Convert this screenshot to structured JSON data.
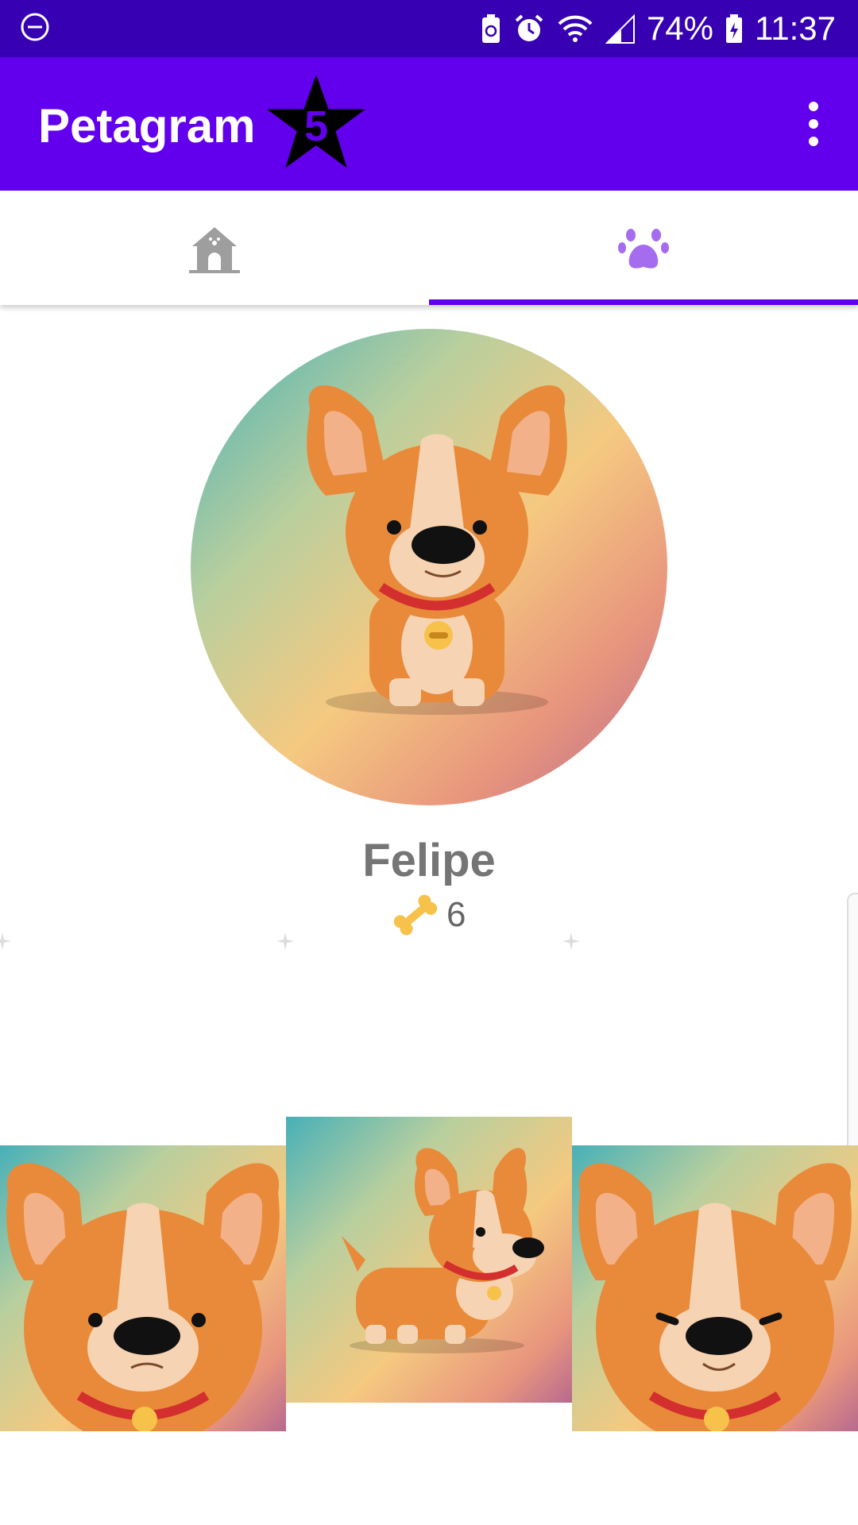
{
  "status_bar": {
    "battery": "74%",
    "time": "11:37",
    "icons": [
      "do-not-disturb-icon",
      "battery-saver-icon",
      "alarm-icon",
      "wifi-icon",
      "signal-icon",
      "battery-icon"
    ]
  },
  "app_bar": {
    "title": "Petagram",
    "star_count": "5",
    "icons": [
      "star-icon",
      "overflow-menu-icon"
    ]
  },
  "tabs": [
    {
      "icon": "dog-house-icon",
      "selected": false
    },
    {
      "icon": "paw-icon",
      "selected": true
    }
  ],
  "profile": {
    "name": "Felipe",
    "likes": "6",
    "likes_icon": "bone-icon"
  },
  "photos": [
    {
      "pose": "front-face-frown"
    },
    {
      "pose": "side-standing"
    },
    {
      "pose": "front-face-smile"
    }
  ],
  "colors": {
    "primary": "#6200ee",
    "primary_dark": "#3700b3",
    "tab_active": "#a56cf0",
    "tab_inactive": "#9e9e9e",
    "dog_orange": "#e88a3a",
    "bone": "#f6c24a"
  }
}
